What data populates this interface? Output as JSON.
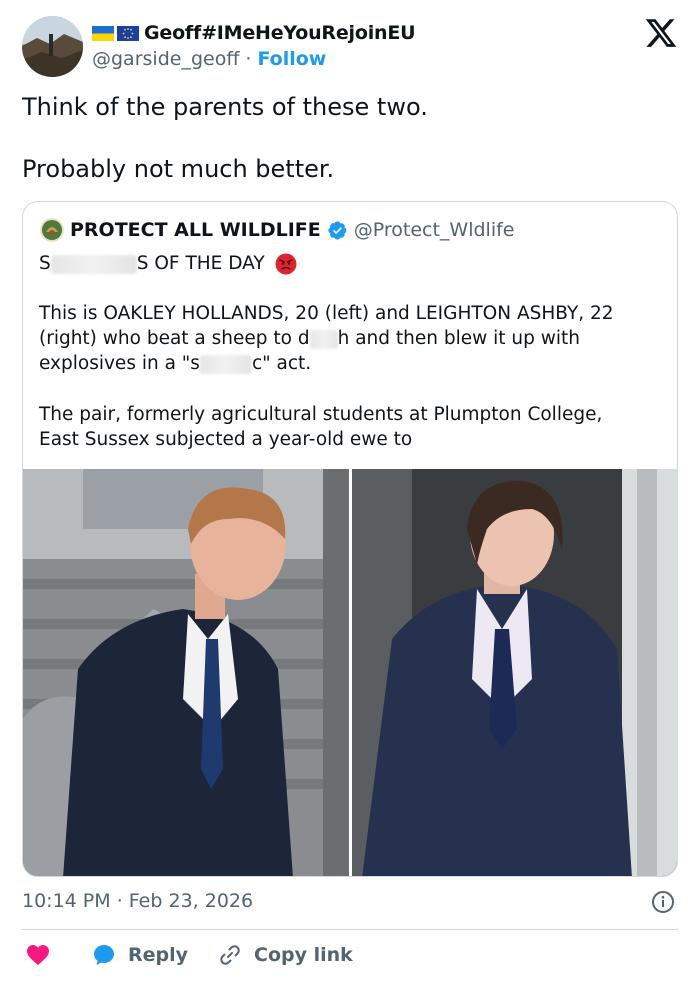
{
  "author": {
    "display_name": "Geoff#IMeHeYouRejoinEU",
    "handle": "@garside_geoff",
    "separator": "·",
    "follow_label": "Follow"
  },
  "tweet": {
    "line1": "Think of the parents of these two.",
    "line2": "Probably not much better."
  },
  "quote": {
    "name": "PROTECT ALL WILDLIFE",
    "handle": "@Protect_Wldlife",
    "headline_start": "S",
    "headline_end": "S OF THE DAY",
    "p1_l1": "This is OAKLEY HOLLANDS, 20 (left) and LEIGHTON ASHBY, 22",
    "p1_l2_a": "(right) who beat a sheep to d",
    "p1_l2_b": "h and then blew it up with",
    "p1_l3_a": "explosives in a \"s",
    "p1_l3_b": "c\" act.",
    "p2_l1": "The pair, formerly agricultural students at Plumpton College,",
    "p2_l2": "East Sussex subjected a year-old ewe to"
  },
  "meta": {
    "time": "10:14 PM",
    "separator": "·",
    "date": "Feb 23, 2026"
  },
  "actions": {
    "reply_label": "Reply",
    "copy_label": "Copy link"
  },
  "colors": {
    "accent": "#1d9bf0",
    "heart": "#f91880",
    "secondary_text": "#536471",
    "border": "#cfd9de"
  }
}
